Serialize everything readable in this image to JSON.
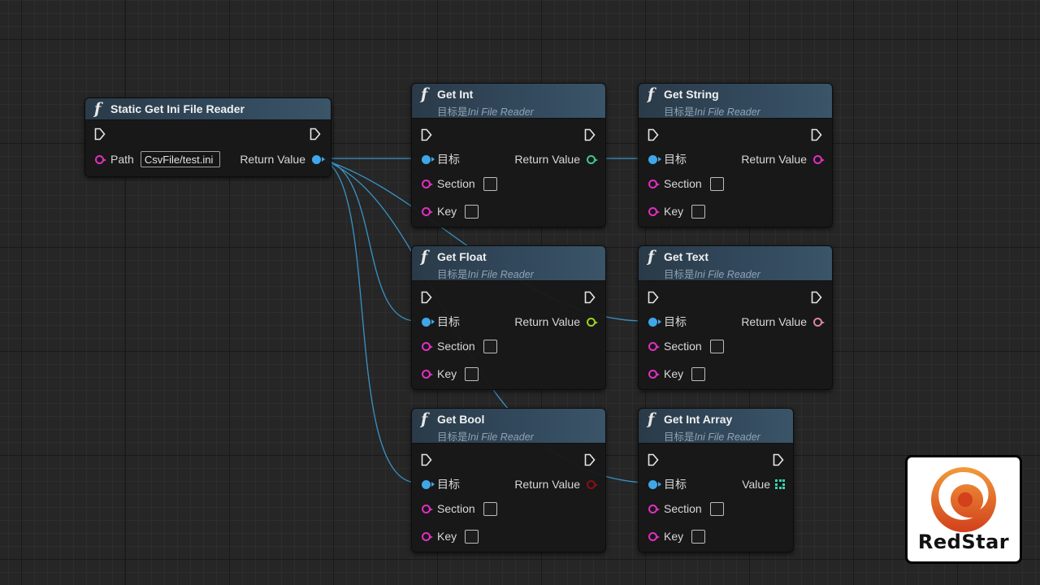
{
  "nodes": {
    "static_reader": {
      "title": "Static Get Ini File Reader",
      "path_label": "Path",
      "path_value": "CsvFile/test.ini",
      "return_label": "Return Value"
    },
    "get_int": {
      "title": "Get Int",
      "subtitle_prefix": "目标是",
      "subtitle_class": "Ini File Reader",
      "target_label": "目标",
      "section_label": "Section",
      "key_label": "Key",
      "return_label": "Return Value"
    },
    "get_string": {
      "title": "Get String",
      "subtitle_prefix": "目标是",
      "subtitle_class": "Ini File Reader",
      "target_label": "目标",
      "section_label": "Section",
      "key_label": "Key",
      "return_label": "Return Value"
    },
    "get_float": {
      "title": "Get Float",
      "subtitle_prefix": "目标是",
      "subtitle_class": "Ini File Reader",
      "target_label": "目标",
      "section_label": "Section",
      "key_label": "Key",
      "return_label": "Return Value"
    },
    "get_text": {
      "title": "Get Text",
      "subtitle_prefix": "目标是",
      "subtitle_class": "Ini File Reader",
      "target_label": "目标",
      "section_label": "Section",
      "key_label": "Key",
      "return_label": "Return Value"
    },
    "get_bool": {
      "title": "Get Bool",
      "subtitle_prefix": "目标是",
      "subtitle_class": "Ini File Reader",
      "target_label": "目标",
      "section_label": "Section",
      "key_label": "Key",
      "return_label": "Return Value"
    },
    "get_int_array": {
      "title": "Get Int Array",
      "subtitle_prefix": "目标是",
      "subtitle_class": "Ini File Reader",
      "target_label": "目标",
      "section_label": "Section",
      "key_label": "Key",
      "return_label": "Value"
    }
  },
  "pin_colors": {
    "object": "#3fa7e8",
    "string": "#e02fc0",
    "int": "#3ec78a",
    "float": "#9ad11f",
    "text": "#d9849c",
    "bool": "#8a1010",
    "int_array": "#33d6b0",
    "wire": "#3a9fd8"
  },
  "icons": {
    "function": "function-icon",
    "exec": "exec-pin-icon"
  },
  "watermark": {
    "brand": "RedStar"
  }
}
